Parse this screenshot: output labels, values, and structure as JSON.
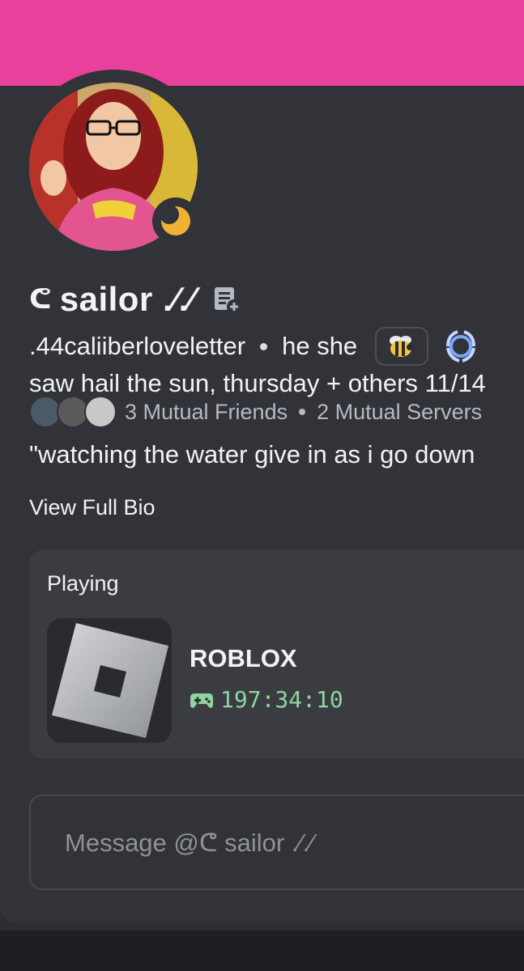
{
  "profile": {
    "display_symbol": "ᕦ",
    "display_name": "sailor .⁄.⁄",
    "username": ".44caliiberloveletter",
    "pronouns": "he she",
    "status": "idle"
  },
  "mutuals": {
    "friends": "3 Mutual Friends",
    "servers": "2 Mutual Servers"
  },
  "bio": {
    "line1": "saw hail the sun, thursday + others 11/14",
    "line2": "\"watching the water give in as i go down",
    "view_full": "View Full Bio"
  },
  "activity": {
    "header": "Playing",
    "game": "ROBLOX",
    "elapsed": "197:34:10"
  },
  "message": {
    "placeholder": "Message @ᕦ sailor .⁄.⁄"
  },
  "colors": {
    "banner": "#e8409b",
    "background": "#313338",
    "idle": "#f0b232",
    "elapsed_green": "#8fd49f"
  },
  "icons": {
    "note": "add-note-icon",
    "badge1": "bee-badge-icon",
    "badge2": "laurel-badge-icon",
    "status": "moon-icon",
    "controller": "gamepad-icon"
  }
}
